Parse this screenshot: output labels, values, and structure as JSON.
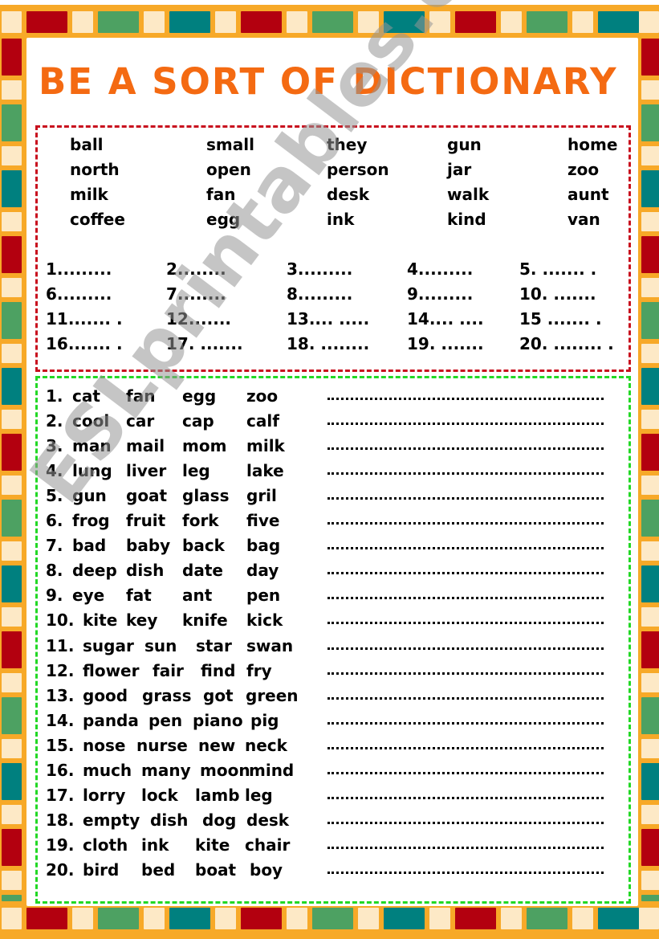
{
  "title": "BE A SORT OF DICTIONARY",
  "colors": {
    "border_orange": "#F7A928",
    "tile_cream": "#FDE9C6",
    "tile_red": "#B3000F",
    "tile_green": "#4DA162",
    "tile_teal": "#00807F",
    "title_orange": "#F46A12",
    "red_box": "#C8101E",
    "green_box": "#22D825"
  },
  "word_bank": [
    [
      "ball",
      "small",
      "they",
      "gun",
      "home"
    ],
    [
      "north",
      "open",
      "person",
      "jar",
      "zoo"
    ],
    [
      "milk",
      "fan",
      "desk",
      "walk",
      "aunt"
    ],
    [
      "coffee",
      "egg",
      "ink",
      "kind",
      "van"
    ]
  ],
  "answer_slots": [
    [
      "1.........",
      "2........",
      "3.........",
      "4.........",
      "5. .......  ."
    ],
    [
      "6.........",
      "7........",
      "8.........",
      "9.........",
      "10. .......  "
    ],
    [
      "11....... .",
      "12.......",
      "13.... .....",
      "14.... ....",
      "15  .......  ."
    ],
    [
      "16....... .",
      "17. .......",
      "18. ........",
      "19. .......",
      "20. ........ ."
    ]
  ],
  "exercise_rows": [
    {
      "num": "1.",
      "words": [
        "cat",
        "fan",
        "egg",
        "zoo"
      ]
    },
    {
      "num": "2.",
      "words": [
        "cool",
        "car",
        "cap",
        "calf"
      ]
    },
    {
      "num": "3.",
      "words": [
        "man",
        "mail",
        "mom",
        "milk"
      ]
    },
    {
      "num": "4.",
      "words": [
        "lung",
        "liver",
        "leg",
        "lake"
      ]
    },
    {
      "num": "5.",
      "words": [
        "gun",
        "goat",
        "glass",
        "gril"
      ]
    },
    {
      "num": "6.",
      "words": [
        "frog",
        "fruit",
        "fork",
        "five"
      ]
    },
    {
      "num": "7.",
      "words": [
        "bad",
        "baby",
        "back",
        "bag"
      ]
    },
    {
      "num": "8.",
      "words": [
        "deep",
        "dish",
        "date",
        "day"
      ]
    },
    {
      "num": "9.",
      "words": [
        "eye",
        "fat",
        "ant",
        "pen"
      ]
    },
    {
      "num": "10.",
      "words": [
        "kite",
        "key",
        "knife",
        "kick"
      ]
    },
    {
      "num": "11.",
      "words": [
        "sugar",
        "sun",
        "star",
        "swan"
      ]
    },
    {
      "num": "12.",
      "words": [
        "flower",
        "fair",
        "find",
        "fry"
      ]
    },
    {
      "num": "13.",
      "words": [
        "good",
        "grass",
        "got",
        "green"
      ]
    },
    {
      "num": "14.",
      "words": [
        "panda",
        "pen",
        "piano",
        "pig"
      ]
    },
    {
      "num": "15.",
      "words": [
        "nose",
        "nurse",
        "new",
        "neck"
      ]
    },
    {
      "num": "16.",
      "words": [
        "much",
        "many",
        "moon",
        "mind"
      ]
    },
    {
      "num": "17.",
      "words": [
        "lorry",
        "lock",
        "lamb",
        "leg"
      ]
    },
    {
      "num": "18.",
      "words": [
        "empty",
        "dish",
        "dog",
        "desk"
      ]
    },
    {
      "num": "19.",
      "words": [
        "cloth",
        "ink",
        "kite",
        "chair"
      ]
    },
    {
      "num": "20.",
      "words": [
        "bird",
        "bed",
        "boat",
        "boy"
      ]
    }
  ],
  "watermark": "ESLprintables.com"
}
